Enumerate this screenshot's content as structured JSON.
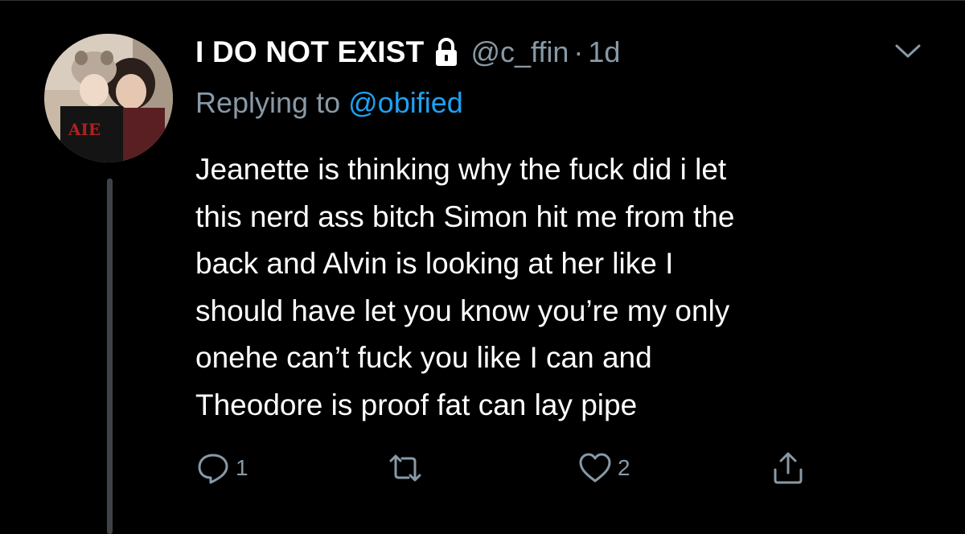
{
  "tweet": {
    "display_name": "I DO NOT EXIST",
    "handle": "@c_ffin",
    "separator": "·",
    "time": "1d",
    "replying_prefix": "Replying to",
    "replying_to": "@obified",
    "text": "Jeanette is thinking why the fuck did i let\nthis nerd ass bitch Simon hit me from the\nback and Alvin is looking at her like I\nshould have let you know you’re my only\nonehe can’t fuck you like I can and\nTheodore is proof fat  can lay pipe",
    "reply_count": "1",
    "retweet_count": "",
    "like_count": "2"
  },
  "icons": {
    "lock": "lock-icon",
    "more": "chevron-down-icon",
    "reply": "reply-icon",
    "retweet": "retweet-icon",
    "like": "heart-icon",
    "share": "share-icon"
  },
  "colors": {
    "background": "#000000",
    "text": "#ffffff",
    "muted": "#8899a6",
    "link": "#1da1f2",
    "thread_line": "#3d4348"
  }
}
